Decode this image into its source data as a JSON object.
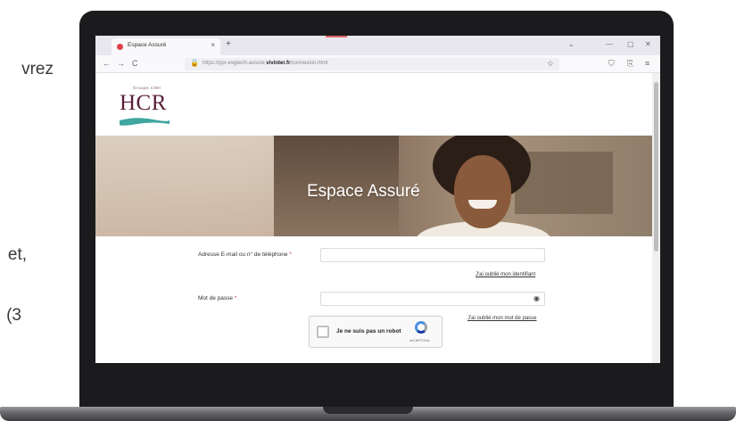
{
  "document": {
    "fragments": [
      "vrez",
      "et,",
      "(3"
    ]
  },
  "browser": {
    "tab_title": "Espace Assuré",
    "tab_close": "×",
    "new_tab": "+",
    "window_controls": [
      "⌄",
      "—",
      "▢",
      "✕"
    ],
    "nav": {
      "back": "←",
      "forward": "→",
      "reload": "C"
    },
    "url_prefix": "https://ppr-exgtech-assure.",
    "url_domain": "vivinter.fr",
    "url_suffix": "/connexion.html",
    "colors": {
      "tab_bar": "#e9e7ee",
      "favicon": "#e0414b"
    }
  },
  "page": {
    "logo_small": "Groupe CIMI",
    "logo": "HCR",
    "hero_title": "Espace Assuré",
    "login_form": {
      "identifier_label": "Adresse E-mail ou n° de téléphone",
      "identifier_value": "",
      "forgot_identifier": "J'ai oublié mon identifiant",
      "password_label": "Mot de passe",
      "password_value": "",
      "forgot_password": "J'ai oublié mon mot de passe",
      "required_mark": "*"
    },
    "captcha": {
      "label": "Je ne suis pas un robot",
      "brand": "reCAPTCHA"
    },
    "colors": {
      "logo": "#5a1f3a",
      "logo_swoosh": "#3fa6a0",
      "required": "#d32f2f"
    }
  },
  "icons": [
    "search-icon",
    "lock-icon",
    "star-icon",
    "shield-icon",
    "extensions-icon",
    "menu-icon",
    "eye-icon",
    "recaptcha-icon"
  ]
}
